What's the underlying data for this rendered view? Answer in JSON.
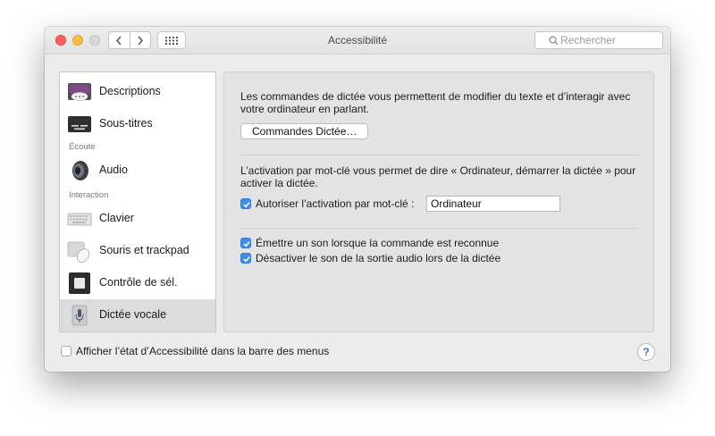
{
  "window": {
    "title": "Accessibilité",
    "search_placeholder": "Rechercher"
  },
  "sidebar": {
    "items": [
      {
        "label": "Descriptions",
        "icon": "descriptions-icon"
      },
      {
        "label": "Sous-titres",
        "icon": "subtitles-icon"
      },
      {
        "label": "Audio",
        "icon": "speaker-icon"
      },
      {
        "label": "Clavier",
        "icon": "keyboard-icon"
      },
      {
        "label": "Souris et trackpad",
        "icon": "mouse-icon"
      },
      {
        "label": "Contrôle de sél.",
        "icon": "switch-control-icon"
      },
      {
        "label": "Dictée vocale",
        "icon": "microphone-icon",
        "selected": true
      }
    ],
    "headers": {
      "ecoute": "Écoute",
      "interaction": "Interaction"
    }
  },
  "panel": {
    "intro_text": "Les commandes de dictée vous permettent de modifier du texte et d’interagir avec votre ordinateur en parlant.",
    "commands_button": "Commandes Dictée…",
    "keyword_text": "L’activation par mot-clé vous permet de dire « Ordinateur, démarrer la dictée » pour activer la dictée.",
    "keyword_checkbox": {
      "label": "Autoriser l’activation par mot-clé :",
      "checked": true
    },
    "keyword_value": "Ordinateur",
    "sound_checkbox": {
      "label": "Émettre un son lorsque la commande est reconnue",
      "checked": true
    },
    "mute_checkbox": {
      "label": "Désactiver le son de la sortie audio lors de la dictée",
      "checked": true
    }
  },
  "footer": {
    "menu_checkbox": {
      "label": "Afficher l’état d’Accessibilité dans la barre des menus",
      "checked": false
    },
    "help": "?"
  },
  "colors": {
    "accent": "#3b8ef0",
    "close": "#fc605c",
    "minimize": "#fdbc40"
  }
}
